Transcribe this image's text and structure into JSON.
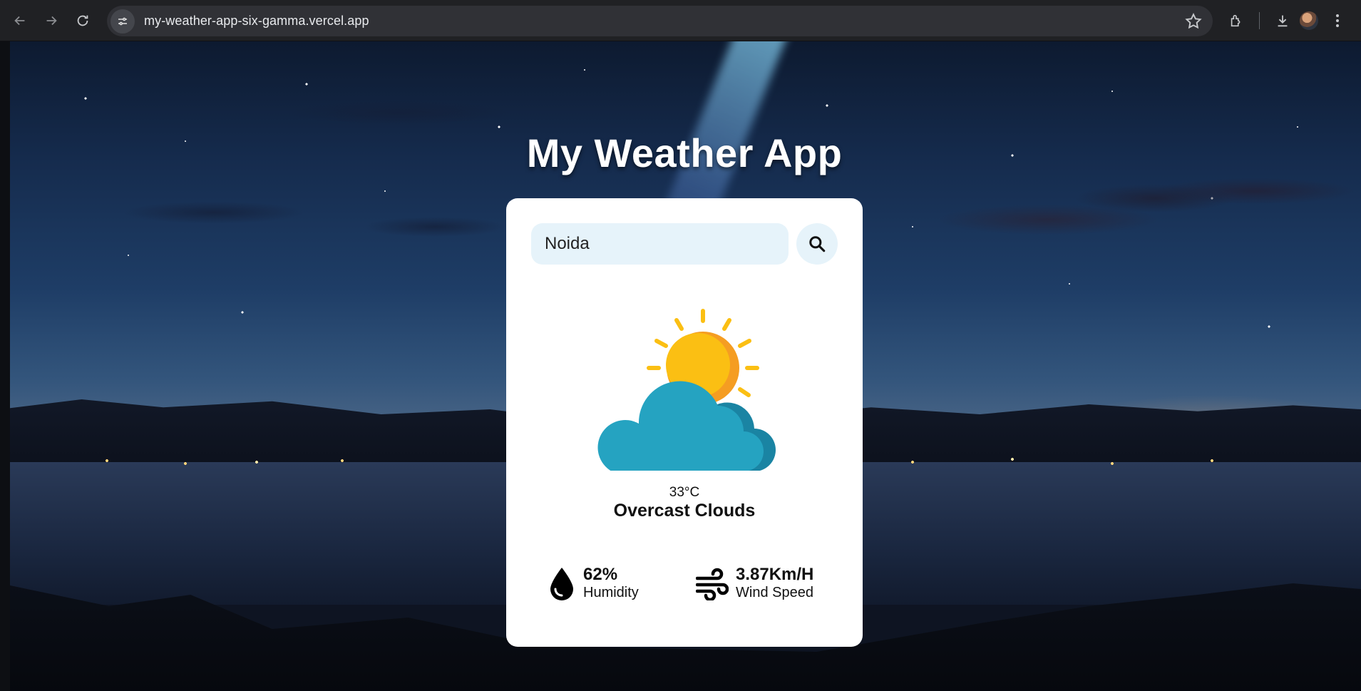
{
  "browser": {
    "url": "my-weather-app-six-gamma.vercel.app",
    "icons": [
      "back-icon",
      "forward-icon",
      "reload-icon",
      "site-info-icon",
      "star-icon",
      "extensions-icon",
      "download-icon",
      "profile-avatar",
      "menu-icon"
    ]
  },
  "app": {
    "title": "My Weather App",
    "search": {
      "value": "Noida",
      "placeholder": "",
      "button_icon": "search-icon"
    },
    "weather": {
      "icon": "partly-cloudy-icon",
      "temperature": "33°C",
      "condition": "Overcast Clouds"
    },
    "stats": {
      "humidity": {
        "value": "62%",
        "label": "Humidity",
        "icon": "humidity-drop-icon"
      },
      "wind": {
        "value": "3.87Km/H",
        "label": "Wind Speed",
        "icon": "wind-icon"
      }
    }
  },
  "colors": {
    "card_bg": "#ffffff",
    "input_bg": "#e6f3fa",
    "sun": "#fbbf13",
    "sun_shade": "#f59d22",
    "cloud": "#25a3c1",
    "cloud_shade": "#1a84a3"
  }
}
